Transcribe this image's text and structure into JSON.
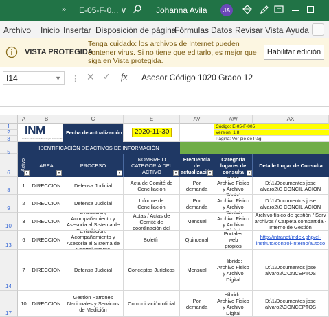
{
  "titlebar": {
    "more": "»",
    "title": "E-05-F-0... ∨",
    "user": "Johanna Avila",
    "avatar": "JA",
    "icons": [
      "search-icon",
      "diamond-icon",
      "pen-icon",
      "display-icon",
      "minimize-icon",
      "maximize-icon"
    ]
  },
  "menu": [
    "Archivo",
    "Inicio",
    "Insertar",
    "Disposición de página",
    "Fórmulas",
    "Datos",
    "Revisar",
    "Vista",
    "Ayuda"
  ],
  "protected": {
    "label": "VISTA PROTEGIDA",
    "message": "Tenga cuidado: los archivos de Internet pueden contener virus. Si no tiene que editarlo, es mejor que siga en Vista protegida.",
    "enable_button": "Habilitar edición"
  },
  "formula": {
    "cell_ref": "I14",
    "content": "Asesor Código 1020 Grado 12"
  },
  "columns": [
    "A",
    "B",
    "C",
    "E",
    "AV",
    "AW",
    "AX"
  ],
  "sheet": {
    "logo_text": "INM",
    "logo_subtext": "Instituto Nacional de Metrología de Colombia",
    "fecha_label": "Fecha de actualización",
    "fecha_value": "2020-11-30",
    "codigo": "Código: E-05-F-005",
    "version": "Versión: 1.8",
    "pagina": "Página: Ver pie de Pág",
    "section_title": "IDENTIFICACIÓN DE ACTIVOS DE INFORMACIÓN",
    "headers": [
      "Activo",
      "AREA",
      "PROCESO",
      "NOMBRE O CATEGORIA DEL ACTIVO",
      "Frecuencia de actualización",
      "Categoría lugares de consulta",
      "Detalle Lugar de Consulta"
    ],
    "rows": [
      {
        "row": "8",
        "activo": "1",
        "area": "DIRECCION",
        "proceso": "Defensa Judicial",
        "nombre": "Acta de Comité de Conciliación",
        "frecuencia": "Por demanda",
        "categoria": "Hibrido: Archivo Fisico y Archivo Digital",
        "detalle": "D:\\1\\Documentos jose alvaro2\\C CONCILIACION"
      },
      {
        "row": "9",
        "activo": "2",
        "area": "DIRECCION",
        "proceso": "Defensa Judicial",
        "nombre": "Informe de Conciliación",
        "frecuencia": "Por demanda",
        "categoria": "Hibrido: Archivo Fisico y Archivo Digital",
        "detalle": "D:\\1\\Documentos jose alvaro2\\C CONCILIACION"
      },
      {
        "row": "10",
        "activo": "3",
        "area": "DIRECCION",
        "proceso": "Evaluación, Acompañamiento y Asesoría al Sistema de Control Interno",
        "nombre": "Actas / Actas de Comité de coordinación del",
        "frecuencia": "Mensual",
        "categoria": "Hibrido: Archivo Fisico y Archivo Digital",
        "detalle": "Archivo físico de gestión / Serv archivos / Carpeta compartida - Interno de Gestión"
      },
      {
        "row": "13",
        "activo": "6",
        "area": "DIRECCION",
        "proceso": "Evaluación, Acompañamiento y Asesoría al Sistema de Control Interno",
        "nombre": "Boletín",
        "frecuencia": "Quincenal",
        "categoria": "Portales web propios",
        "detalle": "http://intranet/index.php/el-instituto/control-interno/autoco"
      },
      {
        "row": "14",
        "activo": "7",
        "area": "DIRECCION",
        "proceso": "Defensa Judicial",
        "nombre": "Conceptos Jurídicos",
        "frecuencia": "Mensual",
        "categoria": "Hibrido: Archivo Fisico y Archivo Digital",
        "detalle": "D:\\1\\Documentos jose alvaro2\\CONCEPTOS"
      },
      {
        "row": "17",
        "activo": "10",
        "area": "DIRECCION",
        "proceso": "Gestión Patrones Nacionales y Servicios de Medición",
        "nombre": "Comunicación oficial",
        "frecuencia": "Por demanda",
        "categoria": "Hibrido: Archivo Fisico y Archivo Digital",
        "detalle": "D:\\1\\Documentos jose alvaro2\\CONCEPTOS"
      }
    ]
  },
  "colors": {
    "accent": "#217346",
    "header_navy": "#1f3864",
    "header_green": "#70ad47",
    "highlight": "#ffff00",
    "link": "#1f4fd1"
  }
}
